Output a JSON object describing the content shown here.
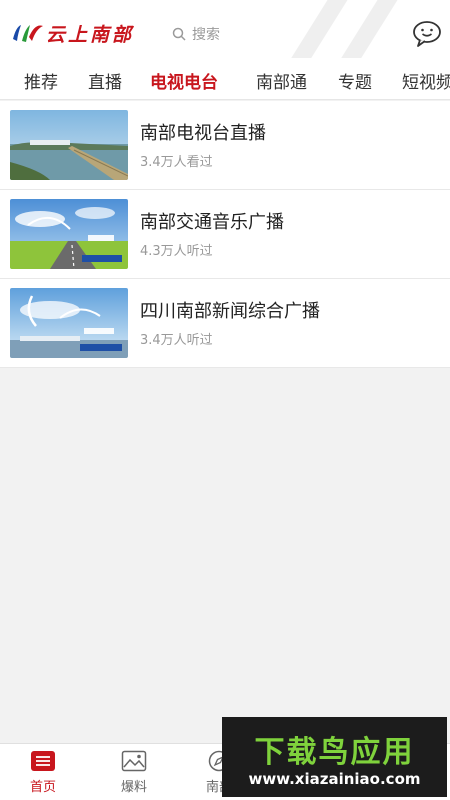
{
  "header": {
    "app_name": "云上南部",
    "search_placeholder": "搜索",
    "accent_color": "#c8161d"
  },
  "tabs": [
    {
      "label": "推荐",
      "active": false
    },
    {
      "label": "直播",
      "active": false
    },
    {
      "label": "电视电台",
      "active": true
    },
    {
      "label": "南部通",
      "active": false
    },
    {
      "label": "专题",
      "active": false
    },
    {
      "label": "短视频",
      "active": false
    }
  ],
  "items": [
    {
      "title": "南部电视台直播",
      "meta": "3.4万人看过"
    },
    {
      "title": "南部交通音乐广播",
      "meta": "4.3万人听过"
    },
    {
      "title": "四川南部新闻综合广播",
      "meta": "3.4万人听过"
    }
  ],
  "bottom_nav": [
    {
      "label": "首页",
      "icon": "home-icon",
      "active": true
    },
    {
      "label": "爆料",
      "icon": "image-icon",
      "active": false
    },
    {
      "label": "南部",
      "icon": "compass-icon",
      "active": false
    }
  ],
  "watermark": {
    "title": "下载鸟应用",
    "url": "www.xiazainiao.com"
  }
}
